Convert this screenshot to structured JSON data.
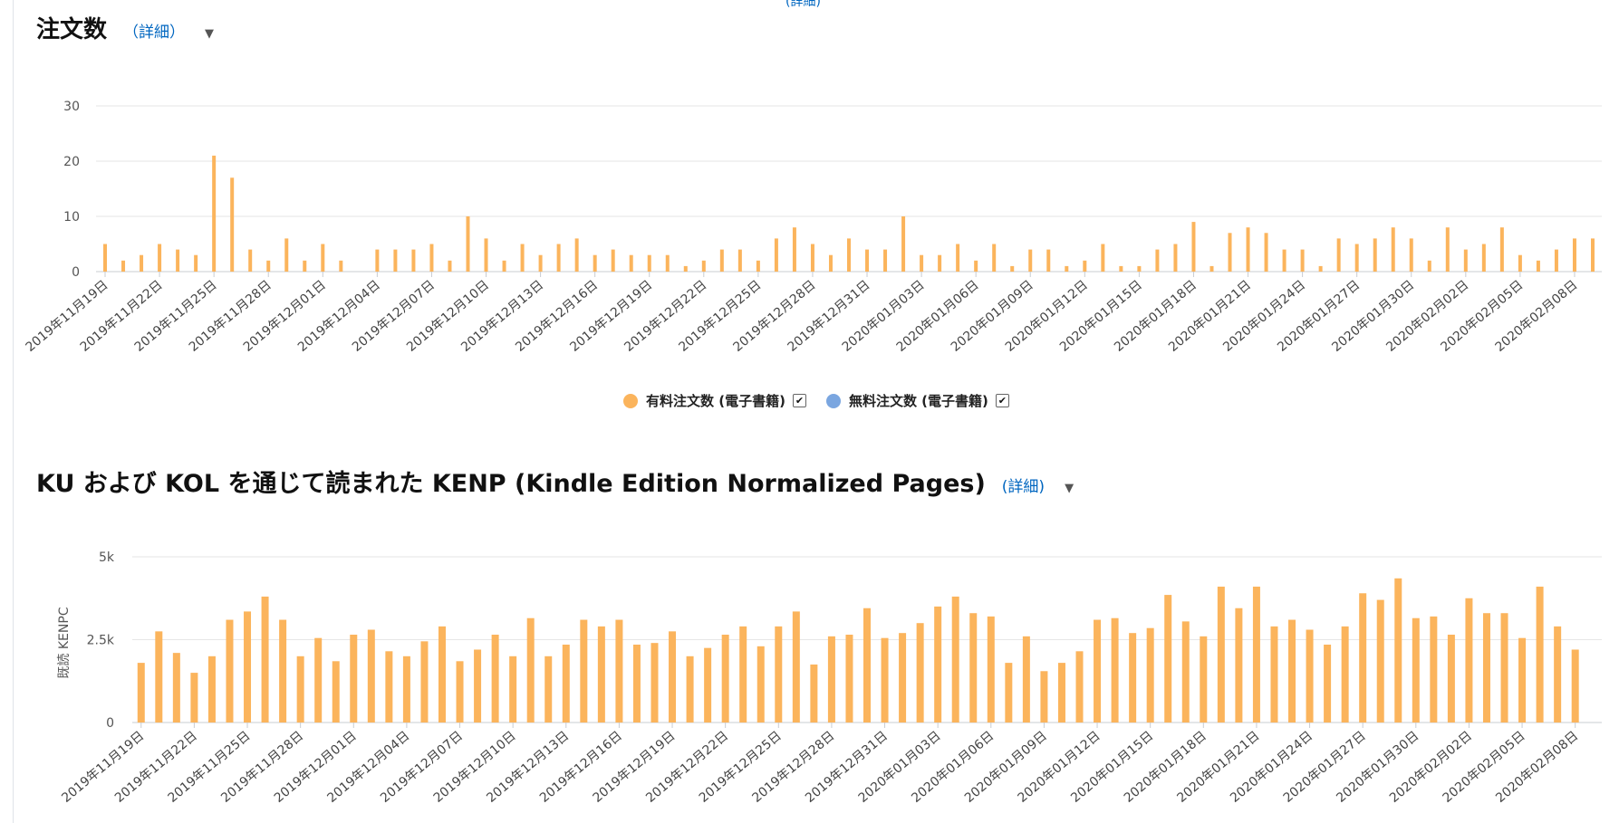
{
  "page": {
    "top_link": "(詳細)",
    "section1": {
      "title": "注文数",
      "detail_link": "（詳細）"
    },
    "section2": {
      "title": "KU および KOL を通じて読まれた KENP (Kindle Edition Normalized Pages)",
      "detail_link": "(詳細)"
    }
  },
  "legend": {
    "items": [
      {
        "label": "有料注文数 (電子書籍)",
        "color": "#fbb45c",
        "checked": true
      },
      {
        "label": "無料注文数 (電子書籍)",
        "color": "#7aa6e0",
        "checked": true
      }
    ]
  },
  "chart_data": [
    {
      "type": "bar",
      "title": "注文数",
      "xlabel": "",
      "ylabel": "",
      "ylim": [
        0,
        30
      ],
      "yticks": [
        0,
        10,
        20,
        30
      ],
      "ytick_labels": [
        "0",
        "10",
        "20",
        "30"
      ],
      "grid": true,
      "x_start": "2019-11-19",
      "tick_every": 3,
      "categories": [
        "2019年11月19日",
        "2019年11月20日",
        "2019年11月21日",
        "2019年11月22日",
        "2019年11月23日",
        "2019年11月24日",
        "2019年11月25日",
        "2019年11月26日",
        "2019年11月27日",
        "2019年11月28日",
        "2019年11月29日",
        "2019年11月30日",
        "2019年12月01日",
        "2019年12月02日",
        "2019年12月03日",
        "2019年12月04日",
        "2019年12月05日",
        "2019年12月06日",
        "2019年12月07日",
        "2019年12月08日",
        "2019年12月09日",
        "2019年12月10日",
        "2019年12月11日",
        "2019年12月12日",
        "2019年12月13日",
        "2019年12月14日",
        "2019年12月15日",
        "2019年12月16日",
        "2019年12月17日",
        "2019年12月18日",
        "2019年12月19日",
        "2019年12月20日",
        "2019年12月21日",
        "2019年12月22日",
        "2019年12月23日",
        "2019年12月24日",
        "2019年12月25日",
        "2019年12月26日",
        "2019年12月27日",
        "2019年12月28日",
        "2019年12月29日",
        "2019年12月30日",
        "2019年12月31日",
        "2020年01月01日",
        "2020年01月02日",
        "2020年01月03日",
        "2020年01月04日",
        "2020年01月05日",
        "2020年01月06日",
        "2020年01月07日",
        "2020年01月08日",
        "2020年01月09日",
        "2020年01月10日",
        "2020年01月11日",
        "2020年01月12日",
        "2020年01月13日",
        "2020年01月14日",
        "2020年01月15日",
        "2020年01月16日",
        "2020年01月17日",
        "2020年01月18日",
        "2020年01月19日",
        "2020年01月20日",
        "2020年01月21日",
        "2020年01月22日",
        "2020年01月23日",
        "2020年01月24日",
        "2020年01月25日",
        "2020年01月26日",
        "2020年01月27日",
        "2020年01月28日",
        "2020年01月29日",
        "2020年01月30日",
        "2020年01月31日",
        "2020年02月01日",
        "2020年02月02日",
        "2020年02月03日",
        "2020年02月04日",
        "2020年02月05日",
        "2020年02月06日",
        "2020年02月07日",
        "2020年02月08日",
        "2020年02月09日"
      ],
      "series": [
        {
          "name": "有料注文数 (電子書籍)",
          "color": "#fbb45c",
          "values": [
            5,
            2,
            3,
            5,
            4,
            3,
            21,
            17,
            4,
            2,
            6,
            2,
            5,
            2,
            0,
            4,
            4,
            4,
            5,
            2,
            10,
            6,
            2,
            5,
            3,
            5,
            6,
            3,
            4,
            3,
            3,
            3,
            1,
            2,
            4,
            4,
            2,
            6,
            8,
            5,
            3,
            6,
            4,
            4,
            10,
            3,
            3,
            5,
            2,
            5,
            1,
            4,
            4,
            1,
            2,
            5,
            1,
            1,
            4,
            5,
            9,
            1,
            7,
            8,
            7,
            4,
            4,
            1,
            6,
            5,
            6,
            8,
            6,
            2,
            8,
            4,
            5,
            8,
            3,
            2,
            4,
            6,
            6
          ]
        }
      ]
    },
    {
      "type": "bar",
      "title": "KU および KOL を通じて読まれた KENP (Kindle Edition Normalized Pages)",
      "xlabel": "",
      "ylabel": "既読 KENPC",
      "ylim": [
        0,
        5000
      ],
      "yticks": [
        0,
        2500,
        5000
      ],
      "ytick_labels": [
        "0",
        "2.5k",
        "5k"
      ],
      "grid": true,
      "x_start": "2019-11-19",
      "tick_every": 3,
      "categories": [
        "2019年11月19日",
        "2019年11月20日",
        "2019年11月21日",
        "2019年11月22日",
        "2019年11月23日",
        "2019年11月24日",
        "2019年11月25日",
        "2019年11月26日",
        "2019年11月27日",
        "2019年11月28日",
        "2019年11月29日",
        "2019年11月30日",
        "2019年12月01日",
        "2019年12月02日",
        "2019年12月03日",
        "2019年12月04日",
        "2019年12月05日",
        "2019年12月06日",
        "2019年12月07日",
        "2019年12月08日",
        "2019年12月09日",
        "2019年12月10日",
        "2019年12月11日",
        "2019年12月12日",
        "2019年12月13日",
        "2019年12月14日",
        "2019年12月15日",
        "2019年12月16日",
        "2019年12月17日",
        "2019年12月18日",
        "2019年12月19日",
        "2019年12月20日",
        "2019年12月21日",
        "2019年12月22日",
        "2019年12月23日",
        "2019年12月24日",
        "2019年12月25日",
        "2019年12月26日",
        "2019年12月27日",
        "2019年12月28日",
        "2019年12月29日",
        "2019年12月30日",
        "2019年12月31日",
        "2020年01月01日",
        "2020年01月02日",
        "2020年01月03日",
        "2020年01月04日",
        "2020年01月05日",
        "2020年01月06日",
        "2020年01月07日",
        "2020年01月08日",
        "2020年01月09日",
        "2020年01月10日",
        "2020年01月11日",
        "2020年01月12日",
        "2020年01月13日",
        "2020年01月14日",
        "2020年01月15日",
        "2020年01月16日",
        "2020年01月17日",
        "2020年01月18日",
        "2020年01月19日",
        "2020年01月20日",
        "2020年01月21日",
        "2020年01月22日",
        "2020年01月23日",
        "2020年01月24日",
        "2020年01月25日",
        "2020年01月26日",
        "2020年01月27日",
        "2020年01月28日",
        "2020年01月29日",
        "2020年01月30日",
        "2020年01月31日",
        "2020年02月01日",
        "2020年02月02日",
        "2020年02月03日",
        "2020年02月04日",
        "2020年02月05日",
        "2020年02月06日",
        "2020年02月07日",
        "2020年02月08日",
        "2020年02月09日"
      ],
      "series": [
        {
          "name": "",
          "color": "#fbb45c",
          "values": [
            1800,
            2750,
            2100,
            1500,
            2000,
            3100,
            3350,
            3800,
            3100,
            2000,
            2550,
            1850,
            2650,
            2800,
            2150,
            2000,
            2450,
            2900,
            1850,
            2200,
            2650,
            2000,
            3150,
            2000,
            2350,
            3100,
            2900,
            3100,
            2350,
            2400,
            2750,
            2000,
            2250,
            2650,
            2900,
            2300,
            2900,
            3350,
            1750,
            2600,
            2650,
            3450,
            2550,
            2700,
            3000,
            3500,
            3800,
            3300,
            3200,
            1800,
            2600,
            1550,
            1800,
            2150,
            3100,
            3150,
            2700,
            2850,
            3850,
            3050,
            2600,
            4100,
            3450,
            4100,
            2900,
            3100,
            2800,
            2350,
            2900,
            3900,
            3700,
            4350,
            3150,
            3200,
            2650,
            3750,
            3300,
            3300,
            2550,
            4100,
            2900,
            2200,
            0
          ]
        }
      ]
    }
  ]
}
